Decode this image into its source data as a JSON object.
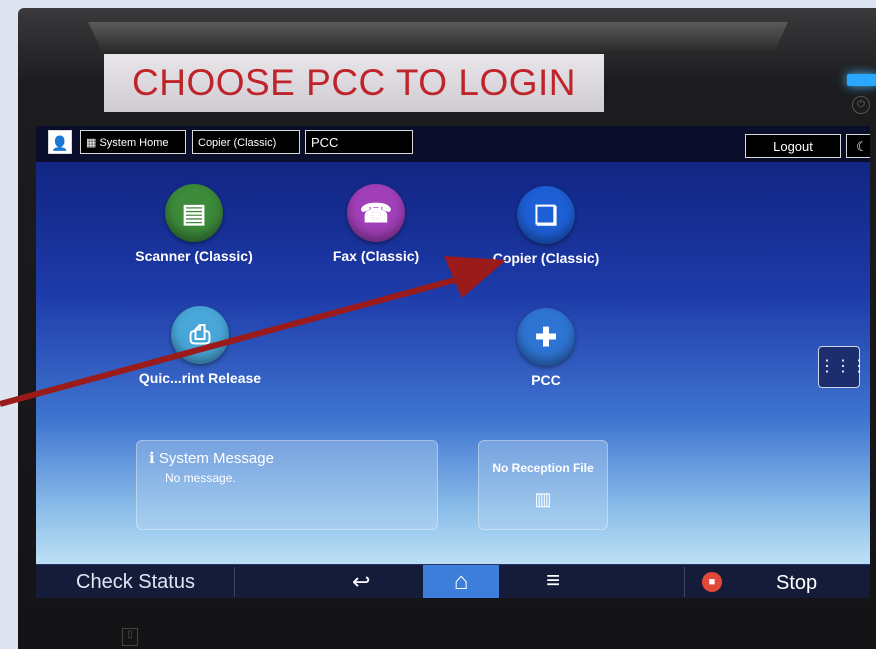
{
  "sticker": {
    "text": "CHOOSE PCC TO LOGIN"
  },
  "topbar": {
    "system_home": "System Home",
    "copier_classic": "Copier (Classic)",
    "pcc": "PCC",
    "logout": "Logout",
    "home_grid_glyph": "⋮⋮⋮",
    "user_glyph": "👤",
    "moon_glyph": "☾"
  },
  "apps": [
    {
      "label": "Scanner (Classic)",
      "icon": "scanner-icon",
      "color": "#3c8a3a"
    },
    {
      "label": "Fax (Classic)",
      "icon": "fax-icon",
      "color": "#a13fb8"
    },
    {
      "label": "Copier (Classic)",
      "icon": "copier-icon",
      "color": "#1d5fd6"
    },
    {
      "label": "Quick Print Release",
      "visible_label": "Quic...rint Release",
      "icon": "print-release-icon",
      "color": "#48a7d8"
    },
    {
      "label": "PCC",
      "icon": "pcc-icon",
      "color": "#2e74d2"
    }
  ],
  "system_message": {
    "title": "System Message",
    "body": "No message."
  },
  "reception": {
    "title": "No Reception File"
  },
  "bottombar": {
    "check_status": "Check Status",
    "stop": "Stop",
    "back_glyph": "↩",
    "home_glyph": "⌂",
    "menu_glyph": "≡"
  },
  "colors": {
    "sticker_text": "#c0242b",
    "home_highlight": "#3d7edb",
    "arrow": "#9b1a1a"
  }
}
